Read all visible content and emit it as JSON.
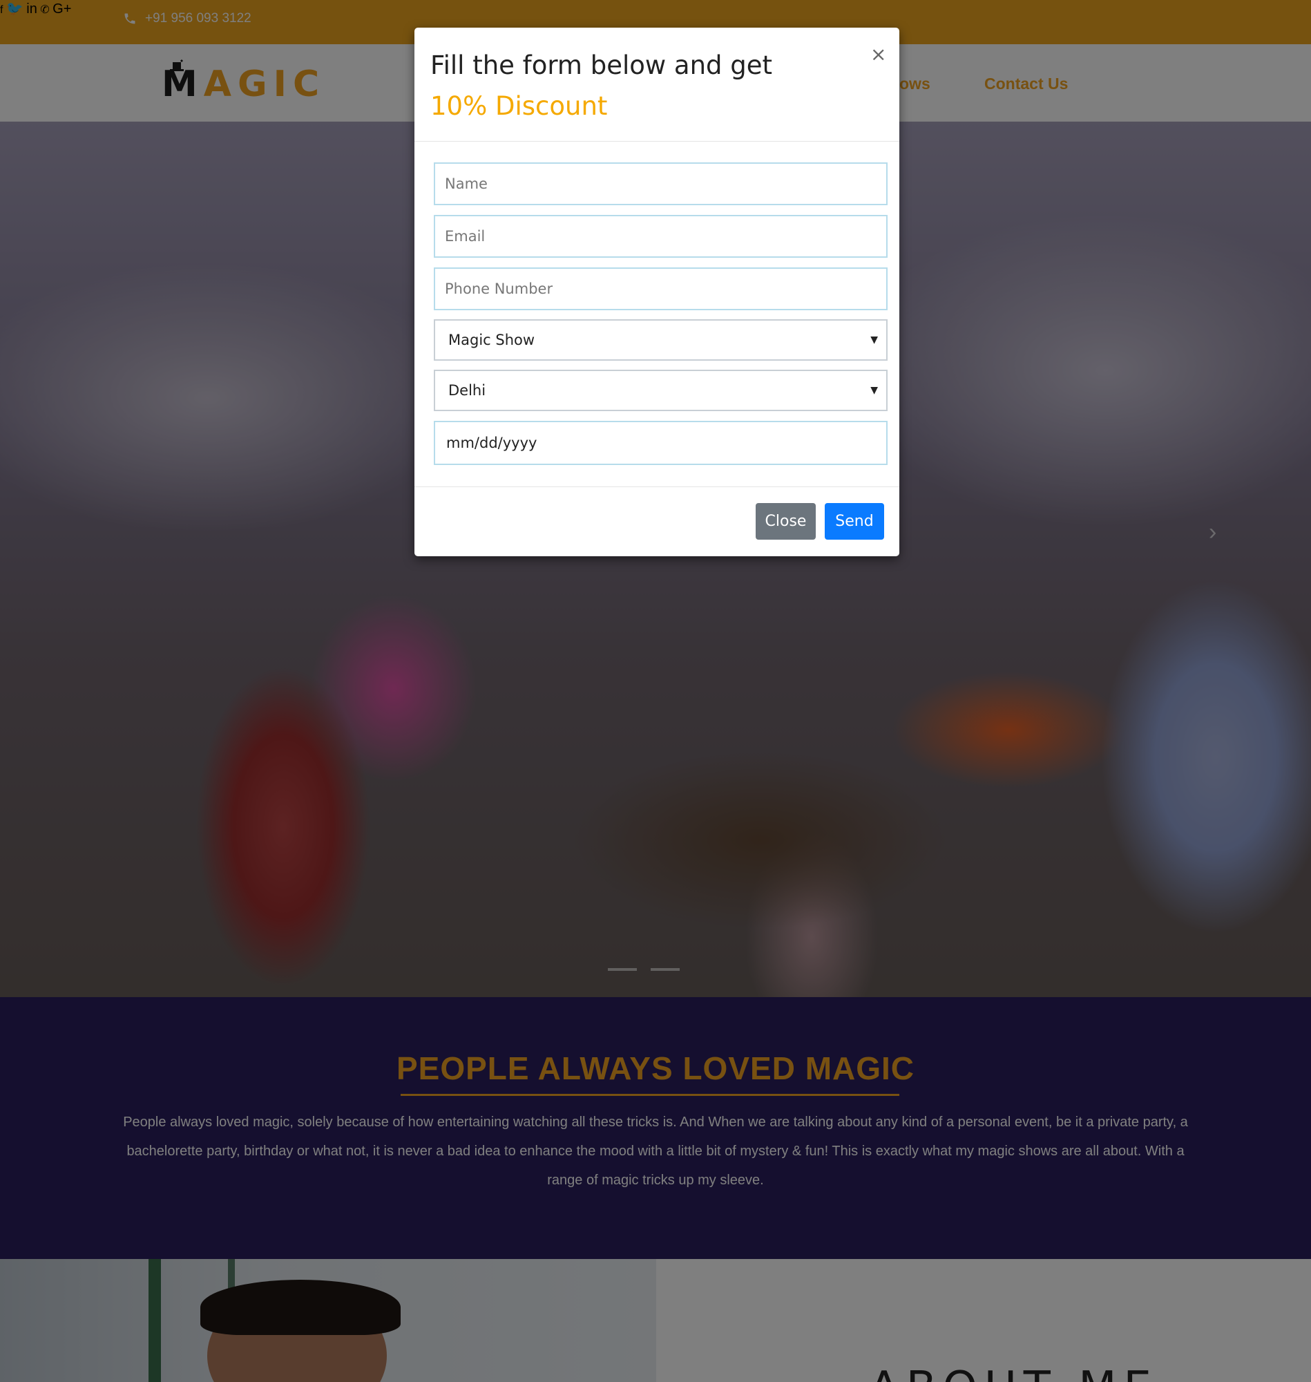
{
  "topbar": {
    "phone": "+91 956 093 3122",
    "social_icons": [
      "facebook-icon",
      "twitter-icon",
      "linkedin-icon",
      "whatsapp-icon",
      "google-plus-icon"
    ],
    "social_glyphs": {
      "facebook": "f",
      "twitter": "🐦",
      "linkedin": "in",
      "whatsapp": "✆",
      "google_plus": "G+"
    }
  },
  "nav": {
    "logo_first": "M",
    "logo_rest": "AGIC",
    "links": [
      "ows",
      "Contact Us"
    ]
  },
  "modal": {
    "title_text": "Fill the form below and get ",
    "title_highlight": "10% Discount",
    "close_x": "×",
    "fields": {
      "name_placeholder": "Name",
      "email_placeholder": "Email",
      "phone_placeholder": "Phone Number",
      "service_selected": "Magic Show",
      "city_selected": "Delhi",
      "date_placeholder": "mm/dd/yyyy"
    },
    "close_label": "Close",
    "send_label": "Send"
  },
  "band": {
    "heading": "PEOPLE ALWAYS LOVED MAGIC",
    "paragraph": "People always loved magic, solely because of how entertaining watching all these tricks is. And When we are talking about any kind of a personal event, be it a private party, a bachelorette party, birthday or what not, it is never a bad idea to enhance the mood with a little bit of mystery & fun! This is exactly what my magic shows are all about. With a range of magic tricks up my sleeve."
  },
  "about": {
    "title": "ABOUT ME"
  },
  "colors": {
    "brand_orange": "#eda51f",
    "band_purple": "#2a1f5e",
    "send_blue": "#0a7bff",
    "close_gray": "#6c757d"
  }
}
